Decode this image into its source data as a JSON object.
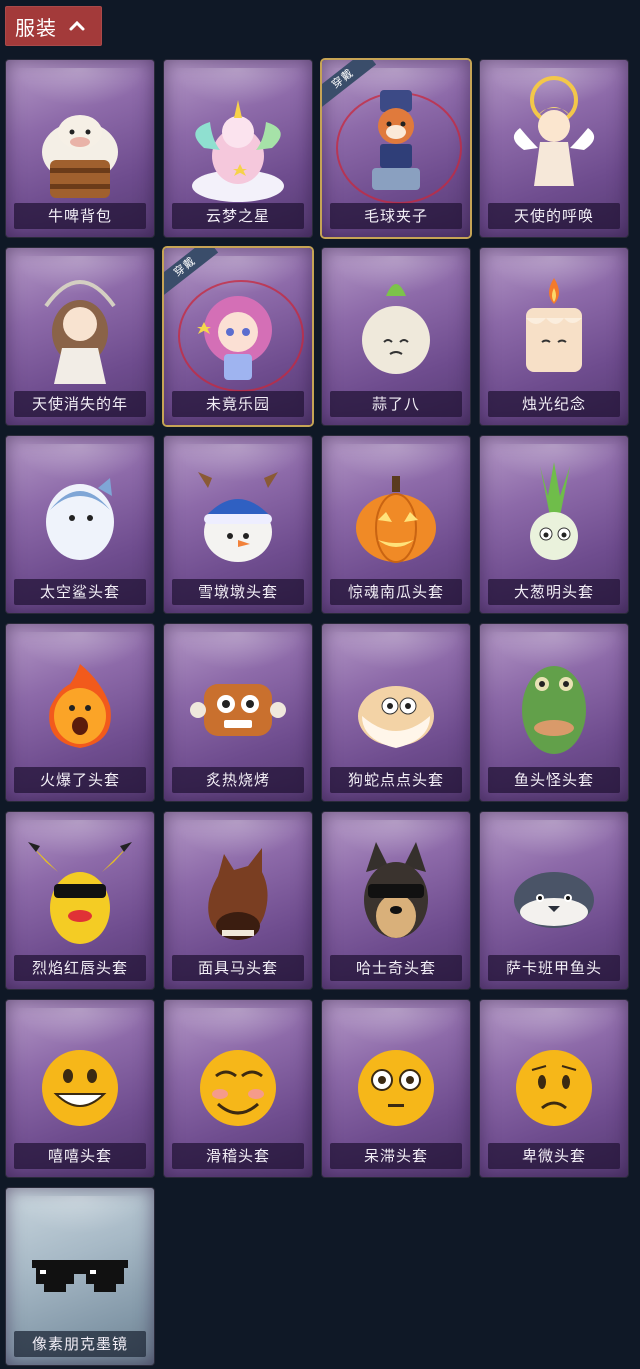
{
  "header": {
    "title": "服装",
    "icon": "chevron-up-icon"
  },
  "worn_badge_text": "穿戴",
  "items": [
    {
      "label": "牛啤背包",
      "worn": false,
      "art": "cow-barrel"
    },
    {
      "label": "云梦之星",
      "worn": false,
      "art": "unicorn-cloud"
    },
    {
      "label": "毛球夹子",
      "worn": true,
      "art": "raccoon-drummer"
    },
    {
      "label": "天使的呼唤",
      "worn": false,
      "art": "angel"
    },
    {
      "label": "天使消失的年",
      "worn": false,
      "art": "angel-girl"
    },
    {
      "label": "未竟乐园",
      "worn": true,
      "art": "pink-girl"
    },
    {
      "label": "蒜了八",
      "worn": false,
      "art": "garlic"
    },
    {
      "label": "烛光纪念",
      "worn": false,
      "art": "candle"
    },
    {
      "label": "太空鲨头套",
      "worn": false,
      "art": "shark"
    },
    {
      "label": "雪墩墩头套",
      "worn": false,
      "art": "snowman"
    },
    {
      "label": "惊魂南瓜头套",
      "worn": false,
      "art": "pumpkin"
    },
    {
      "label": "大葱明头套",
      "worn": false,
      "art": "scallion"
    },
    {
      "label": "火爆了头套",
      "worn": false,
      "art": "fireball"
    },
    {
      "label": "炙热烧烤",
      "worn": false,
      "art": "meat"
    },
    {
      "label": "狗蛇点点头套",
      "worn": false,
      "art": "snake"
    },
    {
      "label": "鱼头怪头套",
      "worn": false,
      "art": "fishhead"
    },
    {
      "label": "烈焰红唇头套",
      "worn": false,
      "art": "pikachu"
    },
    {
      "label": "面具马头套",
      "worn": false,
      "art": "horse"
    },
    {
      "label": "哈士奇头套",
      "worn": false,
      "art": "dog"
    },
    {
      "label": "萨卡班甲鱼头",
      "worn": false,
      "art": "fish"
    },
    {
      "label": "嘻嘻头套",
      "worn": false,
      "art": "emoji-grin"
    },
    {
      "label": "滑稽头套",
      "worn": false,
      "art": "emoji-funny"
    },
    {
      "label": "呆滞头套",
      "worn": false,
      "art": "emoji-stare"
    },
    {
      "label": "卑微头套",
      "worn": false,
      "art": "emoji-humble"
    },
    {
      "label": "像素朋克墨镜",
      "worn": false,
      "art": "pixel-glasses",
      "rarity": "blue"
    }
  ]
}
